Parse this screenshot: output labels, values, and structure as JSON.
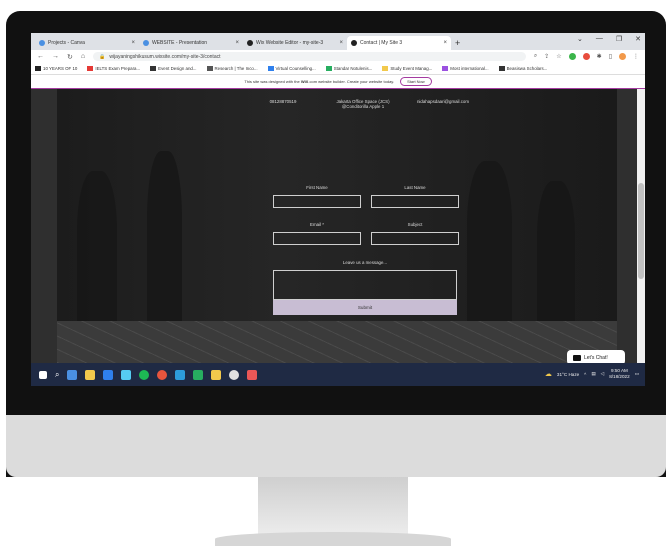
{
  "browser": {
    "tabs": [
      {
        "label": "Projects - Canva",
        "color": "#4a90e2",
        "active": false
      },
      {
        "label": "WEBSITE - Presentation",
        "color": "#4a90e2",
        "active": false
      },
      {
        "label": "Wix Website Editor - my-site-3",
        "color": "#222222",
        "active": false
      },
      {
        "label": "Contact | My Site 3",
        "color": "#222222",
        "active": true
      }
    ],
    "tab_close": "×",
    "new_tab": "+",
    "url": "wijayaningshikusum.wixsite.com/my-site-3/contact",
    "bookmarks": [
      "10 YEARS OF 10",
      "IELTS Exam Prepara...",
      "Event Design and...",
      "Research | The Inco...",
      "Virtual Counselling...",
      "Standar Notulenis...",
      "Study Event Manag...",
      "Most international...",
      "Beasiswa Scholars..."
    ]
  },
  "wix_banner": {
    "text_before": "This site was designed with the",
    "brand": "WiX",
    "text_after": ".com website builder. Create your website today.",
    "button": "Start Now"
  },
  "contact": {
    "phone": "08128870519",
    "address_line1": "Jakarta Office Space (JCS)",
    "address_line2": "@Conditorilla Apple 1",
    "email": "nidahapsdaari@gmail.com"
  },
  "form": {
    "first_name": "First Name",
    "last_name": "Last Name",
    "email": "Email *",
    "subject": "Subject",
    "message": "Leave us a message...",
    "submit": "Submit"
  },
  "chat": {
    "label": "Let's Chat!"
  },
  "taskbar": {
    "weather": "31°C Haze",
    "time": "9:50 AM",
    "date": "8/18/2022"
  }
}
